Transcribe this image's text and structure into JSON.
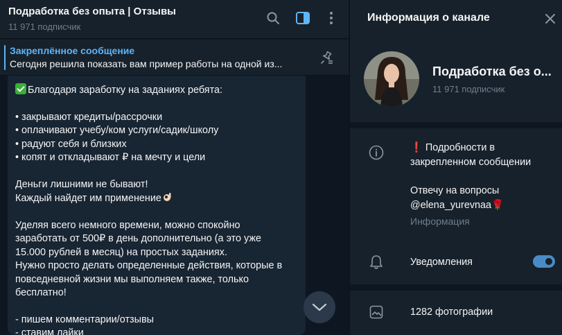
{
  "chat": {
    "title": "Подработка без опыта | Отзывы",
    "subtitle": "11 971 подписчик",
    "icons": [
      "search-icon",
      "sidebar-toggle-icon",
      "more-vertical-icon"
    ]
  },
  "pinned": {
    "title": "Закреплённое сообщение",
    "text": "Сегодня решила показать вам пример работы на одной из..."
  },
  "message": {
    "intro": "Благодаря заработку на заданиях ребята:",
    "bullets": "• закрывают кредиты/рассрочки\n• оплачивают учебу/ком услуги/садик/школу\n• радуют себя и близких\n• копят и откладывают ₽ на мечту и цели",
    "line1": "Деньги лишними не бывают!",
    "line2": "Каждый найдет им применение",
    "para": "Уделяя всего немного времени, можно спокойно\nзаработать от 500₽ в день дополнительно (а это уже\n15.000 рублей в месяц) на простых заданиях.\nНужно просто делать определенные действия, которые в\nповседневной жизни мы выполняем также, только\nбесплатно!",
    "list": "- пишем комментарии/отзывы\n- ставим лайки"
  },
  "info": {
    "title": "Информация о канале",
    "channel_name": "Подработка без о...",
    "subscribers": "11 971 подписчик",
    "desc_mark": "❗",
    "desc_text": "Подробности в закрепленном сообщении\n\nОтвечу на вопросы\n@elena_yurevnaa🌹",
    "desc_label": "Информация",
    "notifications_label": "Уведомления",
    "notifications_on": true,
    "photos_label": "1282 фотографии"
  },
  "colors": {
    "accent": "#5eb5f7",
    "toggle": "#4a8bc6",
    "background": "#0e1621",
    "panel": "#17212b",
    "bubble": "#182533"
  }
}
